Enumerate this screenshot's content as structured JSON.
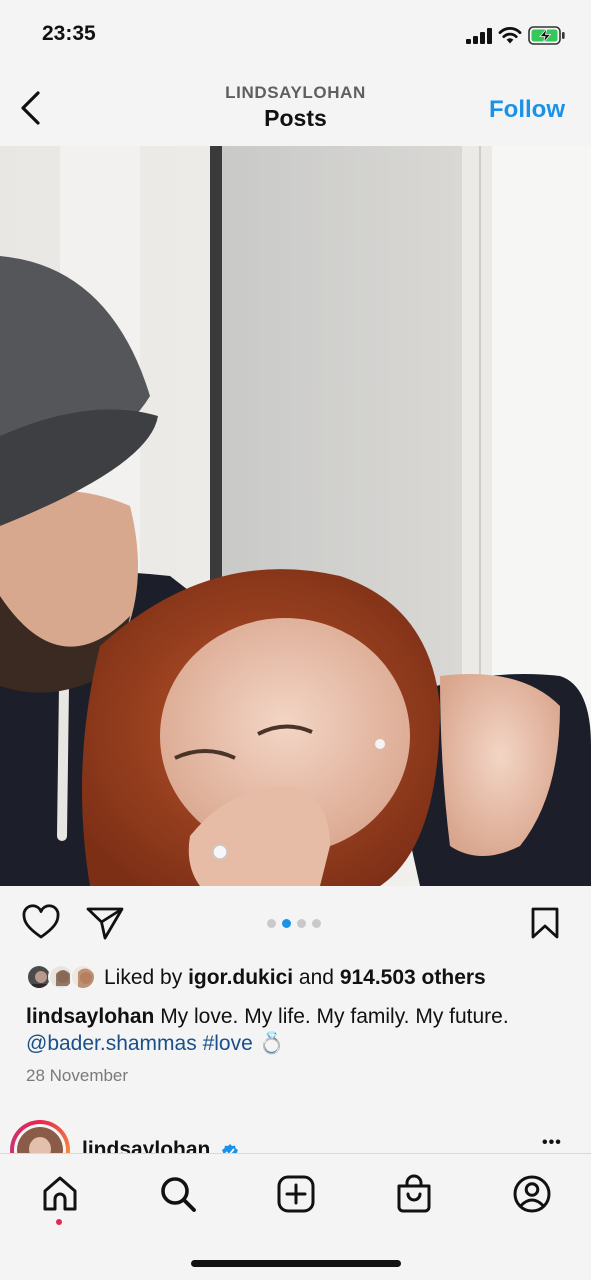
{
  "status_bar": {
    "time": "23:35",
    "icons": [
      "signal-icon",
      "wifi-icon",
      "battery-charging-icon"
    ]
  },
  "header": {
    "username": "LINDSAYLOHAN",
    "title": "Posts",
    "follow_label": "Follow"
  },
  "post": {
    "image_description_icon": "photo",
    "carousel": {
      "count": 4,
      "active": 2
    },
    "likes": {
      "prefix": "Liked by ",
      "user": "igor.dukici",
      "middle": " and ",
      "count": "914.503 others"
    },
    "caption": {
      "user": "lindsaylohan",
      "text": " My love. My life. My family. My future.",
      "mention": "@bader.shammas",
      "hashtag": "#love",
      "emoji": "💍"
    },
    "date": "28 November"
  },
  "next_post": {
    "username": "lindsaylohan",
    "more": "•••"
  },
  "colors": {
    "accent": "#1a92e8",
    "link": "#1b4f8a",
    "notif": "#e6274d"
  }
}
